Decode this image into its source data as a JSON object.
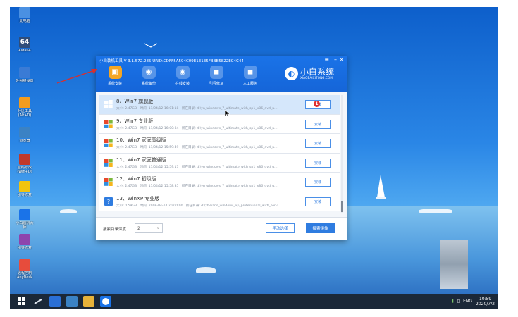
{
  "desktop_icons": [
    {
      "label": "此电脑",
      "icon": "computer-icon",
      "color": "#4a90e2"
    },
    {
      "label": "Aida64",
      "icon": "aida64-icon",
      "color": "#2f4d7a",
      "glyph": "64"
    },
    {
      "label": "外网络设置",
      "icon": "network-icon",
      "color": "#3a7bd5"
    },
    {
      "label": "分区工具\n(Alt+D)",
      "icon": "partition-tool-icon",
      "color": "#f29c1f"
    },
    {
      "label": "浏览器",
      "icon": "browser-icon",
      "color": "#3b82c4"
    },
    {
      "label": "密码修改\n(Win+D)",
      "icon": "password-tool-icon",
      "color": "#c0392b"
    },
    {
      "label": "引导修复",
      "icon": "boot-repair-icon",
      "color": "#f1c40f"
    },
    {
      "label": "小白装机大\n师",
      "icon": "xiaobai-install-icon",
      "color": "#1a73e8"
    },
    {
      "label": "引导修复",
      "icon": "repair-icon",
      "color": "#8e44ad"
    },
    {
      "label": "远程控制\nAnyDesk",
      "icon": "anydesk-icon",
      "color": "#e74c3c"
    }
  ],
  "window": {
    "title": "小白装机工具 V 3.1.572.285 URID:CDFF5A594C09E1E1E5FBBB5822EC4C44",
    "nav": [
      {
        "label": "系统安装",
        "icon": "install-icon",
        "glyph": "▣",
        "active": true
      },
      {
        "label": "系统备份",
        "icon": "backup-icon",
        "glyph": "◉",
        "active": false
      },
      {
        "label": "在线安装",
        "icon": "online-install-icon",
        "glyph": "◉",
        "active": false
      },
      {
        "label": "引导修复",
        "icon": "boot-repair-icon",
        "glyph": "◼",
        "active": false
      },
      {
        "label": "人工服务",
        "icon": "support-icon",
        "glyph": "◼",
        "active": false
      }
    ],
    "brand": {
      "name": "小白系统",
      "url": "XIAOBAIXITONG.COM"
    },
    "list": [
      {
        "name": "8、Win7 旗舰版",
        "size": "大小: 2.47GB",
        "time": "时间: 11/04/12 16:01:18",
        "path": "所在目录: d:\\yn_windows_7_ultimate_with_sp1_x86_dvd_u...",
        "os": "win7",
        "selected": true
      },
      {
        "name": "9、Win7 专业版",
        "size": "大小: 2.47GB",
        "time": "时间: 11/04/12 16:00:34",
        "path": "所在目录: d:\\yn_windows_7_ultimate_with_sp1_x86_dvd_u...",
        "os": "win7",
        "selected": false
      },
      {
        "name": "10、Win7 家庭高级版",
        "size": "大小: 2.47GB",
        "time": "时间: 11/04/12 15:59:49",
        "path": "所在目录: d:\\yn_windows_7_ultimate_with_sp1_x86_dvd_u...",
        "os": "win7",
        "selected": false
      },
      {
        "name": "11、Win7 家庭普通版",
        "size": "大小: 2.47GB",
        "time": "时间: 11/04/12 15:59:17",
        "path": "所在目录: d:\\yn_windows_7_ultimate_with_sp1_x86_dvd_u...",
        "os": "win7",
        "selected": false
      },
      {
        "name": "12、Win7 初级版",
        "size": "大小: 2.47GB",
        "time": "时间: 11/04/12 15:58:35",
        "path": "所在目录: d:\\yn_windows_7_ultimate_with_sp1_x86_dvd_u...",
        "os": "win7",
        "selected": false
      },
      {
        "name": "13、WinXP 专业版",
        "size": "大小: 0.59GB",
        "time": "时间: 2008-04-14 20:00:00",
        "path": "所在目录: d:\\zh-hans_windows_xp_professional_with_serv...",
        "os": "winxp",
        "selected": false
      }
    ],
    "install_label": "安装",
    "badge": "1",
    "depth_label": "搜索目录深度",
    "depth_value": "2",
    "manual_label": "手动选择",
    "search_label": "搜索镜像"
  },
  "taskbar": {
    "items": [
      {
        "icon": "start-icon",
        "color": "#1b2838"
      },
      {
        "icon": "tool-icon",
        "color": "#1b2838"
      },
      {
        "icon": "explorer-icon",
        "color": "#2a6fd6"
      },
      {
        "icon": "network-icon",
        "color": "#3b82c4"
      },
      {
        "icon": "folder-icon",
        "color": "#e8b33a"
      },
      {
        "icon": "xiaobai-icon",
        "color": "#1a73e8"
      }
    ],
    "lang": "ENG",
    "time": "10:59",
    "date": "2020/7/2"
  },
  "colors": {
    "accent": "#1a73e8",
    "badge": "#e12f2f",
    "selected_row": "#d5e7fb"
  }
}
